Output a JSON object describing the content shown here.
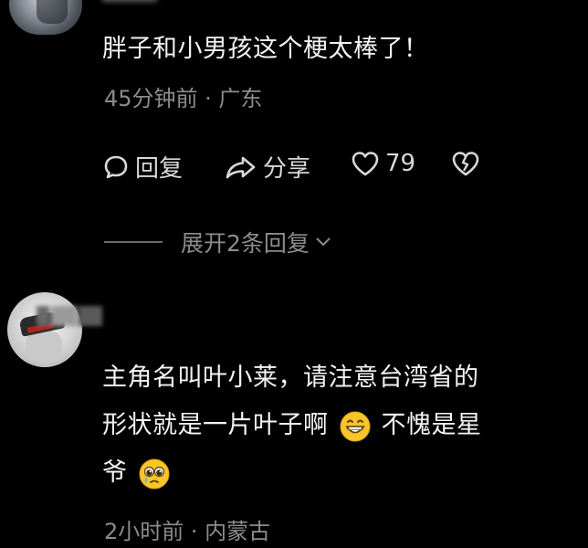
{
  "comment1": {
    "text": "胖子和小男孩这个梗太棒了！",
    "meta": "45分钟前 · 广东",
    "actions": {
      "reply": "回复",
      "share": "分享",
      "like_count": "79"
    },
    "expand_label": "展开2条回复"
  },
  "comment2": {
    "line1": "主角名叫叶小莱，请注意台湾省的",
    "line2a": "形状就是一片叶子啊",
    "line2b": "不愧是星",
    "line3": "爷",
    "meta": "2小时前 · 内蒙古",
    "emoji1": "grinning-face-icon",
    "emoji2": "pleading-face-icon"
  },
  "colors": {
    "background": "#000000",
    "primary_text": "#f4f4f4",
    "secondary_text": "#8c8c8c"
  }
}
